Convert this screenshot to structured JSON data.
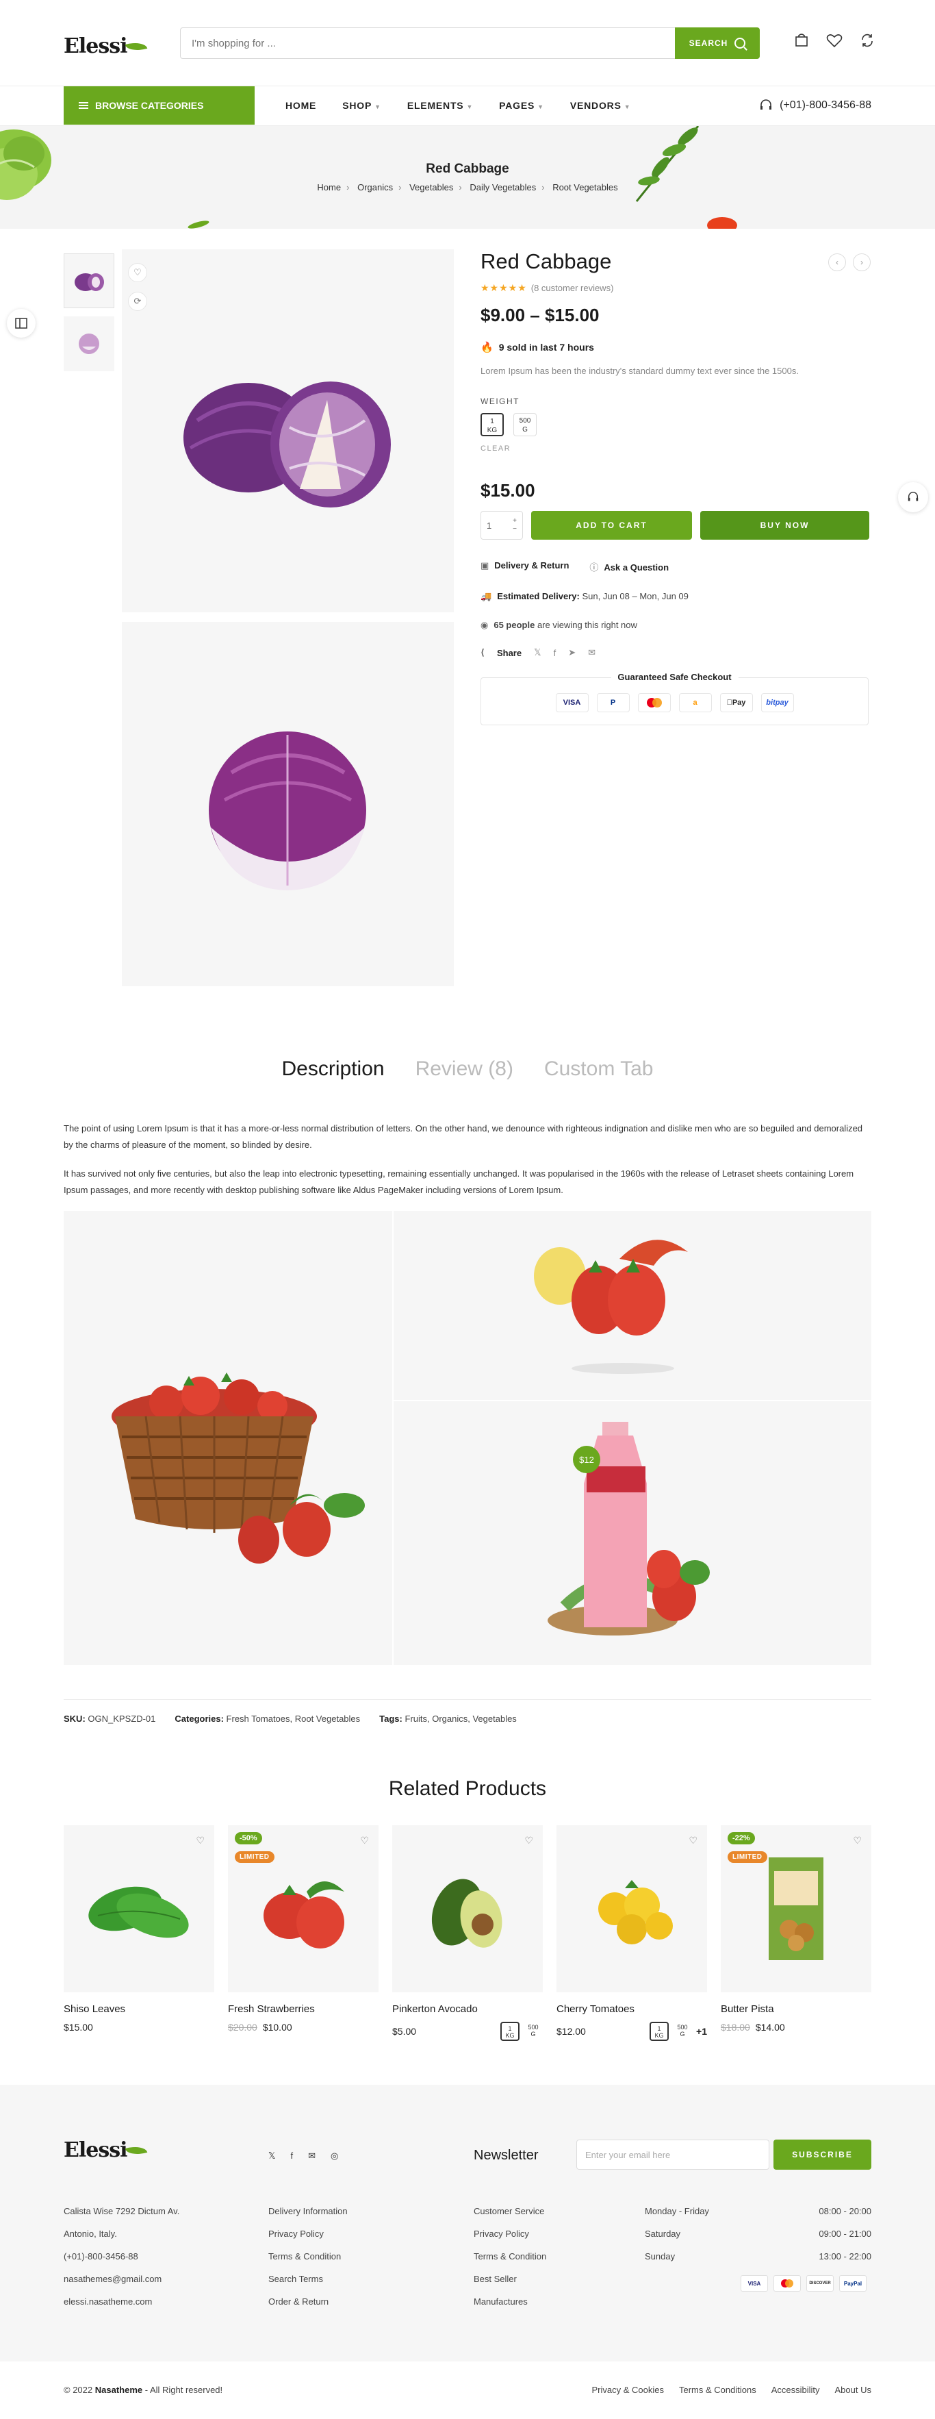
{
  "header": {
    "logo": "Elessi",
    "search_placeholder": "I'm shopping for ...",
    "search_button": "SEARCH",
    "icons": [
      "cart-icon",
      "heart-icon",
      "compare-icon"
    ]
  },
  "nav": {
    "browse": "BROWSE CATEGORIES",
    "menu": [
      "HOME",
      "SHOP",
      "ELEMENTS",
      "PAGES",
      "VENDORS"
    ],
    "phone": "(+01)-800-3456-88"
  },
  "hero": {
    "title": "Red Cabbage",
    "breadcrumbs": [
      "Home",
      "Organics",
      "Vegetables",
      "Daily Vegetables",
      "Root Vegetables"
    ]
  },
  "product": {
    "title": "Red Cabbage",
    "rating_stars": "★★★★★",
    "reviews": "(8 customer reviews)",
    "price_range": "$9.00 – $15.00",
    "sold": "9 sold in last 7 hours",
    "short_desc": "Lorem Ipsum has been the industry's standard dummy text ever since the 1500s.",
    "weight_label": "WEIGHT",
    "weights": [
      {
        "top": "1",
        "bottom": "KG"
      },
      {
        "top": "500",
        "bottom": "G"
      }
    ],
    "clear": "CLEAR",
    "price": "$15.00",
    "qty": "1",
    "add_to_cart": "ADD TO CART",
    "buy_now": "BUY NOW",
    "delivery_return": "Delivery & Return",
    "ask_question": "Ask a Question",
    "est_label": "Estimated Delivery:",
    "est_value": "Sun, Jun 08 – Mon, Jun 09",
    "viewers_count": "65 people",
    "viewers_text": "are viewing this right now",
    "share": "Share",
    "checkout_title": "Guaranteed Safe Checkout",
    "pay_logos": [
      "VISA",
      "P",
      "MC",
      "a",
      "Pay",
      "bitpay"
    ]
  },
  "tabs": [
    "Description",
    "Review (8)",
    "Custom Tab"
  ],
  "description": {
    "p1": "The point of using Lorem Ipsum is that it has a more-or-less normal distribution of letters. On the other hand, we denounce with righteous indignation and dislike men who are so beguiled and demoralized by the charms of pleasure of the moment, so blinded by desire.",
    "p2": "It has survived not only five centuries, but also the leap into electronic typesetting, remaining essentially unchanged. It was popularised in the 1960s with the release of Letraset sheets containing Lorem Ipsum passages, and more recently with desktop publishing software like Aldus PageMaker including versions of Lorem Ipsum.",
    "price_tag": "$12"
  },
  "meta": {
    "sku_label": "SKU:",
    "sku": "OGN_KPSZD-01",
    "cat_label": "Categories:",
    "categories": "Fresh Tomatoes, Root Vegetables",
    "tags_label": "Tags:",
    "tags": "Fruits, Organics, Vegetables"
  },
  "related": {
    "title": "Related Products",
    "items": [
      {
        "name": "Shiso Leaves",
        "price": "$15.00",
        "old": "",
        "off": "",
        "limited": ""
      },
      {
        "name": "Fresh Strawberries",
        "price": "$10.00",
        "old": "$20.00",
        "off": "-50%",
        "limited": "LIMITED"
      },
      {
        "name": "Pinkerton Avocado",
        "price": "$5.00",
        "old": "",
        "off": "",
        "limited": ""
      },
      {
        "name": "Cherry Tomatoes",
        "price": "$12.00",
        "old": "",
        "off": "",
        "limited": "",
        "more": "+1"
      },
      {
        "name": "Butter Pista",
        "price": "$14.00",
        "old": "$18.00",
        "off": "-22%",
        "limited": "LIMITED"
      }
    ]
  },
  "footer": {
    "logo": "Elessi",
    "newsletter": "Newsletter",
    "email_placeholder": "Enter your email here",
    "subscribe": "SUBSCRIBE",
    "address": [
      "Calista Wise 7292 Dictum Av.",
      "Antonio, Italy.",
      "(+01)-800-3456-88",
      "nasathemes@gmail.com",
      "elessi.nasatheme.com"
    ],
    "col2": [
      "Delivery Information",
      "Privacy Policy",
      "Terms & Condition",
      "Search Terms",
      "Order & Return"
    ],
    "col3": [
      "Customer Service",
      "Privacy Policy",
      "Terms & Condition",
      "Best Seller",
      "Manufactures"
    ],
    "hours": [
      {
        "day": "Monday - Friday",
        "time": "08:00 - 20:00"
      },
      {
        "day": "Saturday",
        "time": "09:00 - 21:00"
      },
      {
        "day": "Sunday",
        "time": "13:00 - 22:00"
      }
    ],
    "pays": [
      "VISA",
      "MC",
      "DISCOVER",
      "PayPal"
    ],
    "copyright_pre": "© 2022 ",
    "copyright_brand": "Nasatheme",
    "copyright_post": " - All Right reserved!",
    "bottom_links": [
      "Privacy & Cookies",
      "Terms & Conditions",
      "Accessibility",
      "About Us"
    ]
  },
  "colors": {
    "accent": "#6aa81e",
    "limited": "#e8872a",
    "star": "#f5a623"
  }
}
